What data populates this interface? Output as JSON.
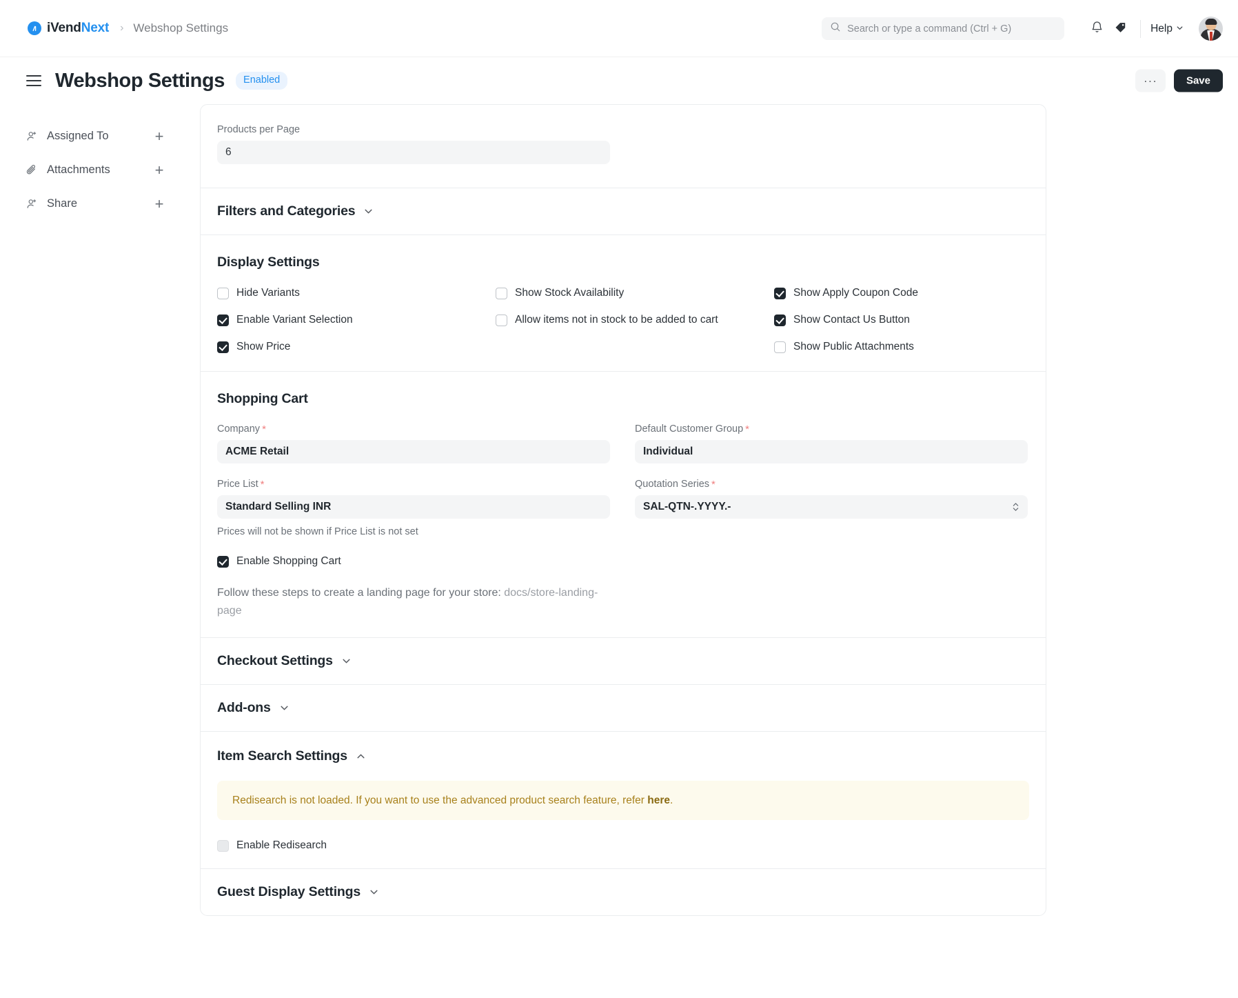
{
  "navbar": {
    "brand_prefix": "iVend",
    "brand_suffix": "Next",
    "brand_mark": "logo-icon",
    "crumb_separator": "›",
    "breadcrumb_current": "Webshop Settings",
    "search_placeholder": "Search or type a command (Ctrl + G)",
    "search_value": "",
    "notification_icon": "bell-icon",
    "tag_icon": "tag-icon",
    "help_label": "Help"
  },
  "page_header": {
    "menu_icon": "hamburger-icon",
    "title": "Webshop Settings",
    "status": "Enabled",
    "more_label": "···",
    "save_label": "Save"
  },
  "sidebar": {
    "items": [
      {
        "label": "Assigned To",
        "icon": "user-plus-icon",
        "add": "+"
      },
      {
        "label": "Attachments",
        "icon": "paperclip-icon",
        "add": "+"
      },
      {
        "label": "Share",
        "icon": "user-share-icon",
        "add": "+"
      }
    ]
  },
  "sections": {
    "products_per_page": {
      "label": "Products per Page",
      "value": "6"
    },
    "filters_and_categories": {
      "title": "Filters and Categories",
      "expanded": false
    },
    "display_settings": {
      "title": "Display Settings",
      "checkboxes": [
        {
          "label": "Hide Variants",
          "checked": false,
          "disabled": false
        },
        {
          "label": "Show Stock Availability",
          "checked": false,
          "disabled": false
        },
        {
          "label": "Show Apply Coupon Code",
          "checked": true,
          "disabled": false
        },
        {
          "label": "Enable Variant Selection",
          "checked": true,
          "disabled": false
        },
        {
          "label": "Allow items not in stock to be added to cart",
          "checked": false,
          "disabled": false
        },
        {
          "label": "Show Contact Us Button",
          "checked": true,
          "disabled": false
        },
        {
          "label": "Show Price",
          "checked": true,
          "disabled": false
        },
        {
          "label": "",
          "checked": false,
          "disabled": false
        },
        {
          "label": "Show Public Attachments",
          "checked": false,
          "disabled": false
        }
      ]
    },
    "shopping_cart": {
      "title": "Shopping Cart",
      "company": {
        "label": "Company",
        "required": true,
        "value": "ACME Retail"
      },
      "default_customer_group": {
        "label": "Default Customer Group",
        "required": true,
        "value": "Individual"
      },
      "price_list": {
        "label": "Price List",
        "required": true,
        "value": "Standard Selling INR",
        "hint": "Prices will not be shown if Price List is not set"
      },
      "quotation_series": {
        "label": "Quotation Series",
        "required": true,
        "value": "SAL-QTN-.YYYY.-"
      },
      "enable_shopping_cart": {
        "label": "Enable Shopping Cart",
        "checked": true
      },
      "landing_hint_text": "Follow these steps to create a landing page for your store: ",
      "landing_hint_link": "docs/store-landing-page"
    },
    "checkout_settings": {
      "title": "Checkout Settings",
      "expanded": false
    },
    "add_ons": {
      "title": "Add-ons",
      "expanded": false
    },
    "item_search_settings": {
      "title": "Item Search Settings",
      "expanded": true,
      "alert_text_before": "Redisearch is not loaded. If you want to use the advanced product search feature, refer ",
      "alert_link": "here",
      "alert_text_after": ".",
      "enable_redisearch": {
        "label": "Enable Redisearch",
        "checked": false,
        "disabled": true
      }
    },
    "guest_display_settings": {
      "title": "Guest Display Settings",
      "expanded": false
    }
  },
  "colors": {
    "accent": "#2490EF",
    "badge_bg": "#eaf3fe",
    "alert_bg": "#fdfaed",
    "alert_text": "#a8811c",
    "dark": "#1f272e"
  }
}
